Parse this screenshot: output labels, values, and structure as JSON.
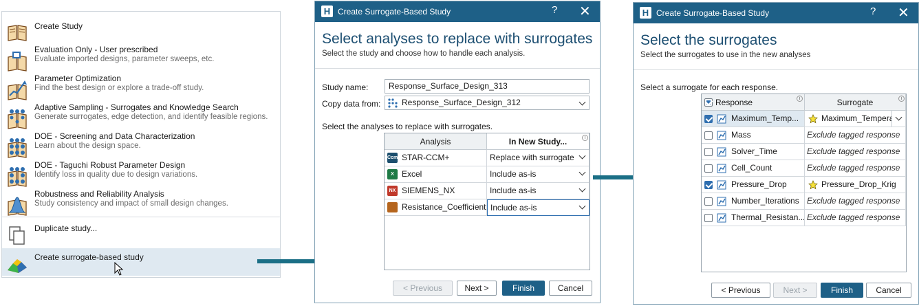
{
  "menu": {
    "items": [
      {
        "title": "Create Study",
        "desc": ""
      },
      {
        "title": "Evaluation Only - User prescribed",
        "desc": "Evaluate imported designs, parameter sweeps, etc."
      },
      {
        "title": "Parameter Optimization",
        "desc": "Find the best design or explore a trade-off study."
      },
      {
        "title": "Adaptive Sampling - Surrogates and Knowledge Search",
        "desc": "Generate surrogates, edge detection, and identify feasible regions."
      },
      {
        "title": "DOE - Screening and Data Characterization",
        "desc": "Learn about the design space."
      },
      {
        "title": "DOE - Taguchi Robust Parameter Design",
        "desc": "Identify loss in quality due to design variations."
      },
      {
        "title": "Robustness and Reliability Analysis",
        "desc": "Study consistency and impact of small design changes."
      },
      {
        "title": "Duplicate study...",
        "desc": ""
      },
      {
        "title": "Create surrogate-based study",
        "desc": ""
      }
    ]
  },
  "dialog1": {
    "window_title": "Create Surrogate-Based Study",
    "help": "?",
    "close": "✕",
    "heading": "Select analyses to replace with surrogates",
    "subheading": "Select the study and choose how to handle each analysis.",
    "study_name_label": "Study name:",
    "study_name_value": "Response_Surface_Design_313",
    "copy_from_label": "Copy data from:",
    "copy_from_value": "Response_Surface_Design_312",
    "instruction": "Select the analyses to replace with surrogates.",
    "col_analysis": "Analysis",
    "col_new_study": "In New Study...",
    "rows": [
      {
        "analysis": "STAR-CCM+",
        "badge": "Ccm",
        "badge_color": "#1c4f6e",
        "action": "Replace with surrogate"
      },
      {
        "analysis": "Excel",
        "badge": "X",
        "badge_color": "#1d7a45",
        "action": "Include as-is"
      },
      {
        "analysis": "SIEMENS_NX",
        "badge": "NX",
        "badge_color": "#c0392b",
        "action": "Include as-is"
      },
      {
        "analysis": "Resistance_Coefficient",
        "badge": "",
        "badge_color": "#b5651d",
        "action": "Include as-is"
      }
    ],
    "btn_previous": "< Previous",
    "btn_next": "Next >",
    "btn_finish": "Finish",
    "btn_cancel": "Cancel"
  },
  "dialog2": {
    "window_title": "Create Surrogate-Based Study",
    "help": "?",
    "close": "✕",
    "heading": "Select the surrogates",
    "subheading": "Select the surrogates to use in the new analyses",
    "instruction": "Select a surrogate for each response.",
    "col_response": "Response",
    "col_surrogate": "Surrogate",
    "rows": [
      {
        "response": "Maximum_Temp...",
        "checked": true,
        "surrogate": "Maximum_Tempera",
        "has_star": true,
        "exclude": false
      },
      {
        "response": "Mass",
        "checked": false,
        "surrogate": "Exclude tagged response",
        "has_star": false,
        "exclude": true
      },
      {
        "response": "Solver_Time",
        "checked": false,
        "surrogate": "Exclude tagged response",
        "has_star": false,
        "exclude": true
      },
      {
        "response": "Cell_Count",
        "checked": false,
        "surrogate": "Exclude tagged response",
        "has_star": false,
        "exclude": true
      },
      {
        "response": "Pressure_Drop",
        "checked": true,
        "surrogate": "Pressure_Drop_Krig",
        "has_star": true,
        "exclude": false
      },
      {
        "response": "Number_Iterations",
        "checked": false,
        "surrogate": "Exclude tagged response",
        "has_star": false,
        "exclude": true
      },
      {
        "response": "Thermal_Resistan...",
        "checked": false,
        "surrogate": "Exclude tagged response",
        "has_star": false,
        "exclude": true
      }
    ],
    "btn_previous": "< Previous",
    "btn_next": "Next >",
    "btn_finish": "Finish",
    "btn_cancel": "Cancel"
  },
  "colors": {
    "accent": "#1e6087",
    "arrow": "#1b6f86",
    "highlight": "#dfe9f1"
  }
}
